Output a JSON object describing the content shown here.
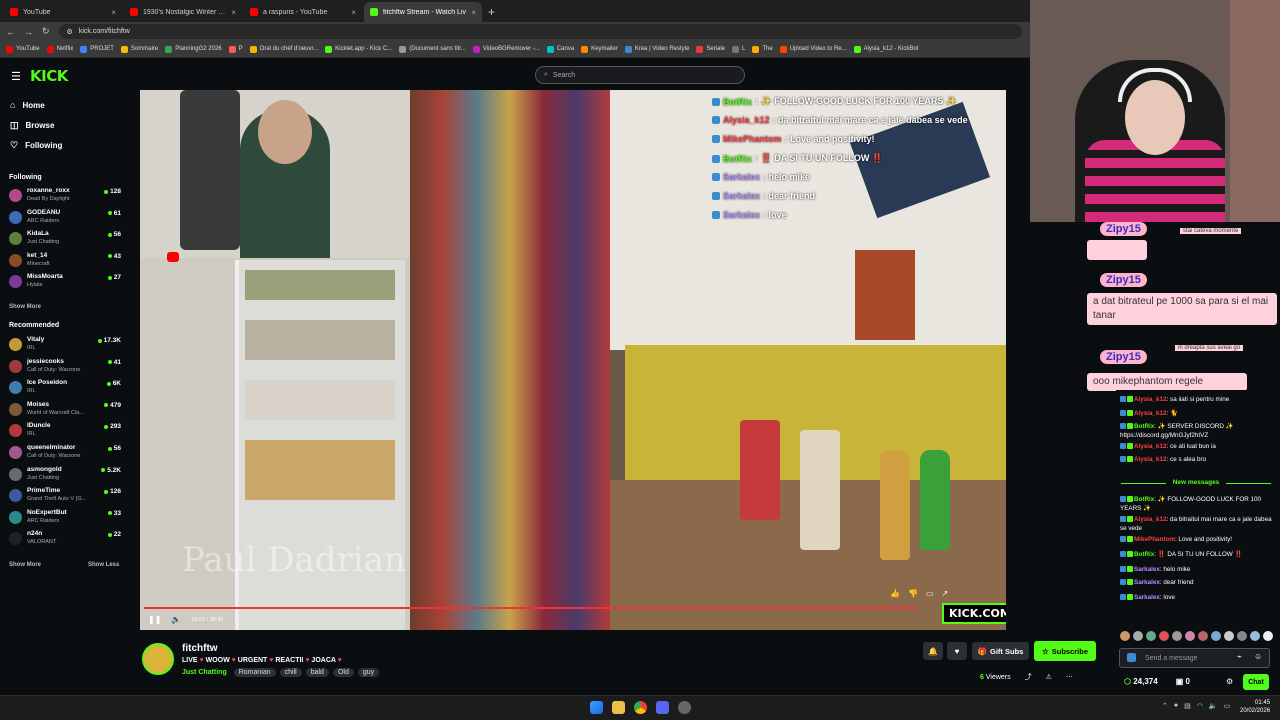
{
  "browser": {
    "tabs": [
      {
        "title": "YouTube",
        "color": "#ff0000",
        "active": false
      },
      {
        "title": "1930's Nostalgic Winter Jazz Pl",
        "color": "#ff0000",
        "active": false
      },
      {
        "title": "a raspuns - YouTube",
        "color": "#ff0000",
        "active": false
      },
      {
        "title": "fitchftw Stream - Watch Liv",
        "color": "#53fc18",
        "active": true
      }
    ],
    "url": "kick.com/fitchftw",
    "bookmarks": [
      "YouTube",
      "Netflix",
      "PROJET",
      "Sommaire",
      "PlanningG2 2026",
      "P",
      "Oral du chef d'oeuvr...",
      "Kicklet.app - Kick C...",
      "(Document sans titr...",
      "VideoBGRemover -...",
      "Canva",
      "Keymailer",
      "Krea | Video Restyle",
      "Seriale",
      "L",
      "The",
      "Upload Video to Re...",
      "Alysia_k12 - KickBot"
    ]
  },
  "header": {
    "logo": "KICK",
    "search_placeholder": "Search"
  },
  "sidebar": {
    "nav": [
      {
        "label": "Home",
        "icon": "home-icon"
      },
      {
        "label": "Browse",
        "icon": "browse-icon"
      },
      {
        "label": "Following",
        "icon": "heart-icon"
      }
    ],
    "following_title": "Following",
    "following": [
      {
        "name": "roxanne_roxx",
        "game": "Dead By Daylight",
        "viewers": "128",
        "color": "#b04a8a"
      },
      {
        "name": "GODEANU",
        "game": "ARC Raiders",
        "viewers": "61",
        "color": "#3a6db5"
      },
      {
        "name": "KidaLa",
        "game": "Just Chatting",
        "viewers": "56",
        "color": "#5f7f3a"
      },
      {
        "name": "ket_14",
        "game": "Minecraft",
        "viewers": "43",
        "color": "#8a4a2a"
      },
      {
        "name": "MissMoarta",
        "game": "Hytale",
        "viewers": "27",
        "color": "#7a3a9a"
      }
    ],
    "show_more_1": "Show More",
    "recommended_title": "Recommended",
    "recommended": [
      {
        "name": "Vitaly",
        "game": "IRL",
        "viewers": "17.3K",
        "color": "#c49a3a"
      },
      {
        "name": "jessiecooks",
        "game": "Call of Duty: Warzone",
        "viewers": "41",
        "color": "#a03a3a"
      },
      {
        "name": "Ice Poseidon",
        "game": "IRL",
        "viewers": "6K",
        "color": "#3a7fb0"
      },
      {
        "name": "Moises",
        "game": "World of Warcraft Cla...",
        "viewers": "479",
        "color": "#7a5a3a"
      },
      {
        "name": "IDuncle",
        "game": "IRL",
        "viewers": "293",
        "color": "#b03a3a"
      },
      {
        "name": "queenelminator",
        "game": "Call of Duty: Warzone",
        "viewers": "56",
        "color": "#a05a8a"
      },
      {
        "name": "asmongold",
        "game": "Just Chatting",
        "viewers": "5.2K",
        "color": "#6a6a6a"
      },
      {
        "name": "PrimeTime",
        "game": "Grand Theft Auto V (G...",
        "viewers": "126",
        "color": "#3a5a9a"
      },
      {
        "name": "NoExpertBut",
        "game": "ARC Raiders",
        "viewers": "33",
        "color": "#2a8a8a"
      },
      {
        "name": "n24n",
        "game": "VALORANT",
        "viewers": "22",
        "color": "#222222"
      }
    ],
    "show_more_2": "Show More",
    "show_less": "Show Less"
  },
  "video": {
    "watermark": "Paul Dadrian",
    "time": "33:07 / 36:42",
    "kick_url_overlay": "KICK.COM/FITCHFTW",
    "progress": 0.9,
    "overlay_chat": [
      {
        "user": "BotRix",
        "user_color": "#53fc18",
        "text": ": ✨ FOLLOW-GOOD LUCK FOR 100 YEARS ✨"
      },
      {
        "user": "Alysia_k12",
        "user_color": "#ff3f3f",
        "text": ": da bitraitul mai mare ca e jale dabea se vede"
      },
      {
        "user": "MikePhantom",
        "user_color": "#ff3f3f",
        "text": ": Love and positivity!"
      },
      {
        "user": "BotRix",
        "user_color": "#53fc18",
        "text": ": ‼️ DA SI TU UN FOLLOW ‼️"
      },
      {
        "user": "Sarkalex",
        "user_color": "#b58cff",
        "text": ": helo mike"
      },
      {
        "user": "Sarkalex",
        "user_color": "#b58cff",
        "text": ": dear friend"
      },
      {
        "user": "Sarkalex",
        "user_color": "#b58cff",
        "text": ": love"
      }
    ]
  },
  "channel": {
    "name": "fitchftw",
    "title_parts": [
      "LIVE",
      "WOOW",
      "URGENT",
      "REACTII",
      "JOACA"
    ],
    "category": "Just Chatting",
    "tags": [
      "Romanian",
      "chill",
      "bald",
      "Old",
      "guy"
    ],
    "gift_subs_label": "Gift Subs",
    "subscribe_label": "Subscribe",
    "viewers_count": "6",
    "viewers_label": "Viewers"
  },
  "overlay_right": {
    "pink_messages": [
      {
        "user": "Zipy15",
        "text": ""
      },
      {
        "user": "Zipy15",
        "text": "a dat bitrateul pe 1000 sa para si el mai tanar"
      },
      {
        "user": "Zipy15",
        "text": "ooo mikephantom regele"
      }
    ],
    "partial_text_1": "stai cateva momente",
    "partial_text_2": "in dreapta sus aveai go"
  },
  "chat": {
    "messages": [
      {
        "user": "Alysia_k12",
        "color": "#ff3f3f",
        "text": ": sa iiati si pentru mine"
      },
      {
        "user": "Alysia_k12",
        "color": "#ff3f3f",
        "text": ": 🐈"
      },
      {
        "user": "BotRix",
        "color": "#53fc18",
        "text": ": ✨ SERVER DISCORD ✨ https://discord.gg/MnGJyf2htVZ"
      },
      {
        "user": "Alysia_k12",
        "color": "#ff3f3f",
        "text": ": ce ati luat bun ia"
      },
      {
        "user": "Alysia_k12",
        "color": "#ff3f3f",
        "text": ": ce s alea bro"
      }
    ],
    "new_messages_label": "New messages",
    "messages_after": [
      {
        "user": "BotRix",
        "color": "#53fc18",
        "text": ": ✨ FOLLOW-GOOD LUCK FOR 100 YEARS ✨"
      },
      {
        "user": "Alysia_k12",
        "color": "#ff3f3f",
        "text": ": da bitraitul mai mare ca e jale dabea se vede"
      },
      {
        "user": "MikePhantom",
        "color": "#ff3f3f",
        "text": ": Love and positivity!"
      },
      {
        "user": "BotRix",
        "color": "#53fc18",
        "text": ": ‼️ DA SI TU UN FOLLOW ‼️"
      },
      {
        "user": "Sarkalex",
        "color": "#b58cff",
        "text": ": helo mike"
      },
      {
        "user": "Sarkalex",
        "color": "#b58cff",
        "text": ": dear friend"
      },
      {
        "user": "Sarkalex",
        "color": "#b58cff",
        "text": ": love"
      }
    ],
    "input_placeholder": "Send a message",
    "points": "24,374",
    "points_2": "0",
    "chat_button": "Chat"
  },
  "taskbar": {
    "time": "01:45",
    "date": "20/02/2026"
  }
}
